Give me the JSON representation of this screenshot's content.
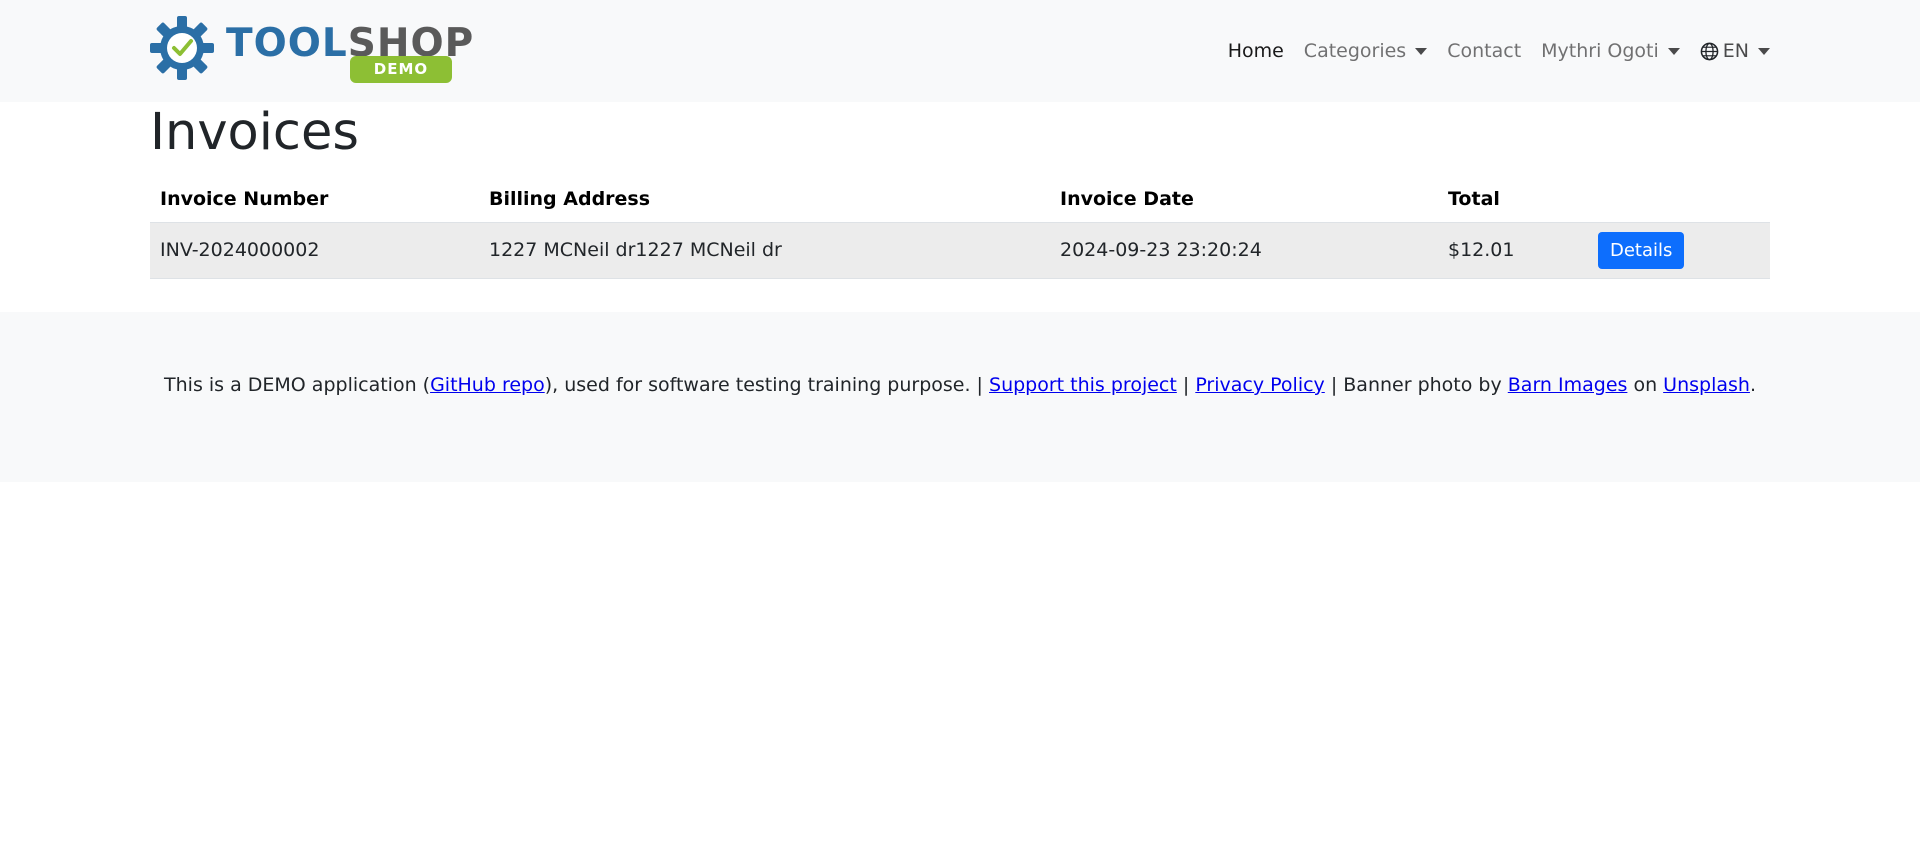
{
  "brand": {
    "logo_text_tool": "TOOL",
    "logo_text_shop": "SHOP",
    "logo_badge": "DEMO",
    "colors": {
      "tool": "#2b6fa6",
      "shop": "#5a5a5a",
      "badge": "#8dbf34"
    }
  },
  "nav": {
    "home": "Home",
    "categories": "Categories",
    "contact": "Contact",
    "user": "Mythri Ogoti",
    "language": "EN"
  },
  "page": {
    "title": "Invoices"
  },
  "table": {
    "headers": {
      "invoice_number": "Invoice Number",
      "billing_address": "Billing Address",
      "invoice_date": "Invoice Date",
      "total": "Total"
    },
    "rows": [
      {
        "invoice_number": "INV-2024000002",
        "billing_address": "1227 MCNeil dr1227 MCNeil dr",
        "invoice_date": "2024-09-23 23:20:24",
        "total": "$12.01",
        "action": "Details"
      }
    ]
  },
  "footer": {
    "t1": "This is a DEMO application (",
    "github": "GitHub repo",
    "t2": "), used for software testing training purpose. | ",
    "support": "Support this project",
    "t3": " | ",
    "privacy": "Privacy Policy",
    "t4": " | Banner photo by ",
    "barn": "Barn Images",
    "t5": " on ",
    "unsplash": "Unsplash",
    "t6": "."
  },
  "colors": {
    "primary": "#0d6efd",
    "navbar_bg": "#f8f9fa",
    "row_bg": "#ececec",
    "link": "#0000ee"
  }
}
